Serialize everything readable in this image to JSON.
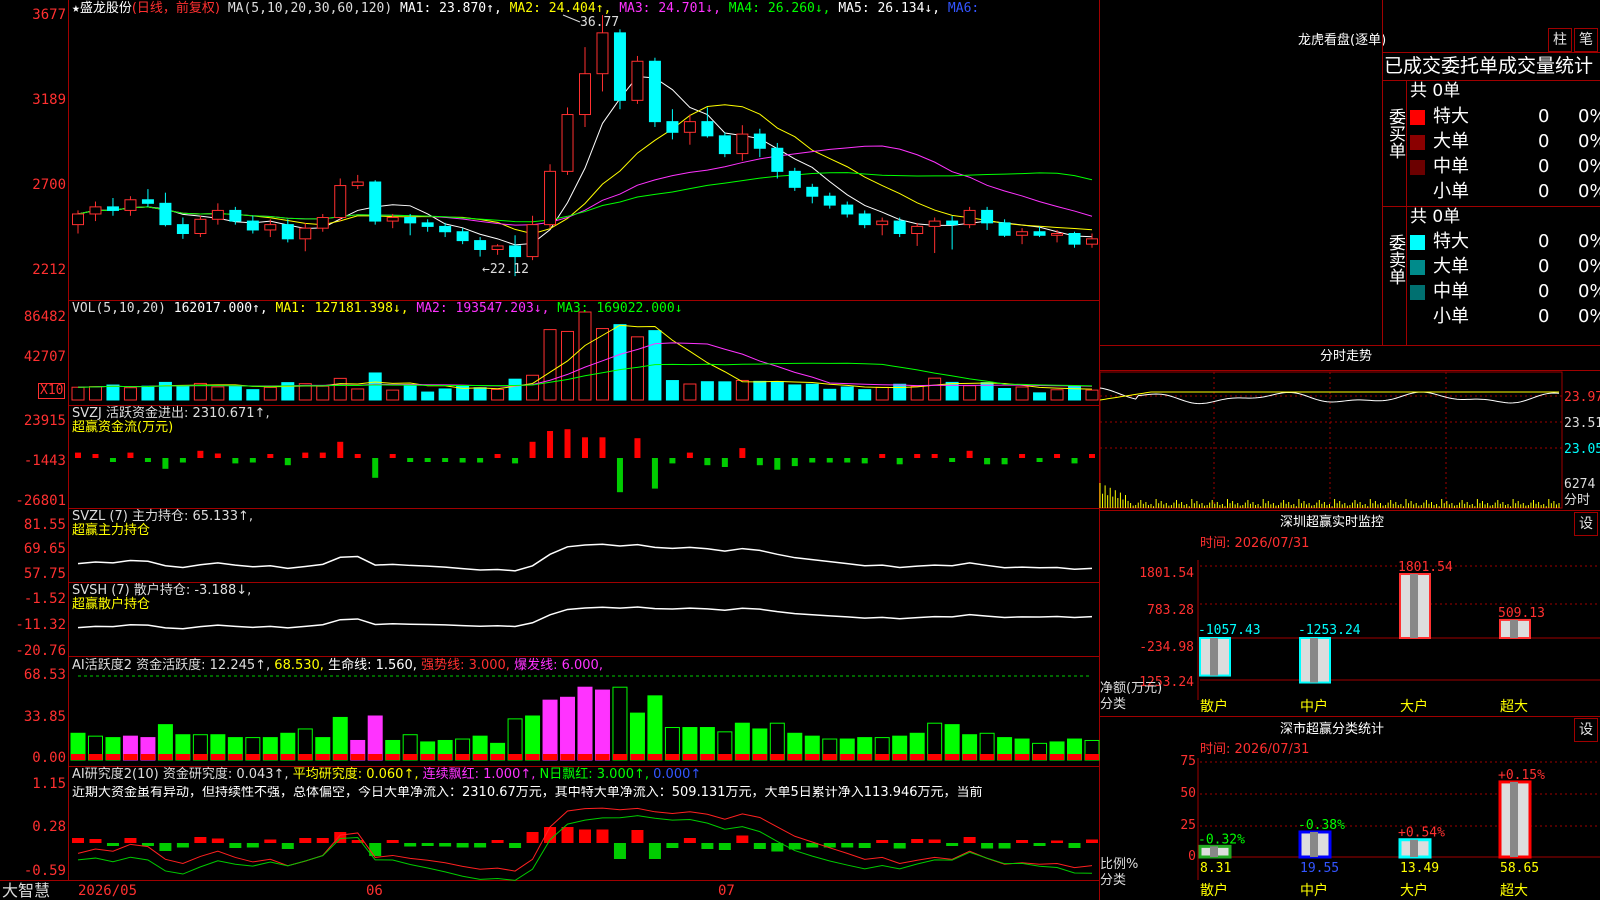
{
  "app": {
    "logo": "大智慧",
    "star": "★"
  },
  "main": {
    "stock": "盛龙股份",
    "mode": "(日线，前复权)",
    "ma_label": "MA(5,10,20,30,60,120)",
    "ma1": "MA1: 23.870↑,",
    "ma2": "MA2: 24.404↑,",
    "ma3": "MA3: 24.701↓,",
    "ma4": "MA4: 26.260↓,",
    "ma5": "MA5: 26.134↓,",
    "ma6": "MA6:",
    "yticks": [
      "3677",
      "3189",
      "2700",
      "2212"
    ],
    "high_label": "36.77",
    "low_label": "←22.12"
  },
  "vol": {
    "label": "VOL(5,10,20)",
    "value": "162017.000↑,",
    "ma1": "MA1: 127181.398↓,",
    "ma2": "MA2: 193547.203↓,",
    "ma3": "MA3: 169022.000↓",
    "yticks": [
      "86482",
      "42707"
    ],
    "unit": "X10"
  },
  "svzj": {
    "label": "SVZJ  活跃资金进出: 2310.671↑,",
    "sub": "超赢资金流(万元)",
    "yticks": [
      "23915",
      "-1443",
      "-26801"
    ]
  },
  "svzl": {
    "label": "SVZL (7) 主力持仓: 65.133↑,",
    "sub": "超赢主力持仓",
    "yticks": [
      "81.55",
      "69.65",
      "57.75"
    ]
  },
  "svsh": {
    "label": "SVSH (7) 散户持仓: -3.188↓,",
    "sub": "超赢散户持仓",
    "yticks": [
      "-1.52",
      "-11.32",
      "-20.76"
    ]
  },
  "ai1": {
    "label": "AI活跃度2 资金活跃度: 12.245↑,",
    "v2": "68.530,",
    "v3": "生命线: 1.560,",
    "v4": "强势线: 3.000,",
    "v5": "爆发线: 6.000,",
    "yticks": [
      "68.53",
      "33.85",
      "0.00"
    ]
  },
  "ai2": {
    "label": "AI研究度2(10) 资金研究度: 0.043↑,",
    "v2": "平均研究度: 0.060↑,",
    "v3": "连续飘红: 1.000↑,",
    "v4": "N日飘红: 3.000↑,",
    "v5": "0.000↑",
    "comment": "近期大资金虽有异动，但持续性不强，总体偏空，今日大单净流入：2310.67万元，其中特大单净流入：509.131万元，大单5日累计净入113.946万元，当前",
    "yticks": [
      "1.15",
      "0.28",
      "-0.59"
    ]
  },
  "xaxis": {
    "labels": [
      "2026/05",
      "06",
      "07"
    ]
  },
  "panel_lhb": {
    "title": "龙虎看盘(逐单)",
    "btn1": "柱",
    "btn2": "笔",
    "subtitle": "已成交委托单成交量统计",
    "buy": {
      "side": "委买单",
      "total": "共 0单",
      "rows": [
        {
          "name": "特大",
          "count": "0",
          "pct": "0%",
          "color": "#ff0000"
        },
        {
          "name": "大单",
          "count": "0",
          "pct": "0%",
          "color": "#8b0000"
        },
        {
          "name": "中单",
          "count": "0",
          "pct": "0%",
          "color": "#6b0000"
        },
        {
          "name": "小单",
          "count": "0",
          "pct": "0%",
          "color": "#000000"
        }
      ]
    },
    "sell": {
      "side": "委卖单",
      "total": "共 0单",
      "rows": [
        {
          "name": "特大",
          "count": "0",
          "pct": "0%",
          "color": "#00ffff"
        },
        {
          "name": "大单",
          "count": "0",
          "pct": "0%",
          "color": "#008b8b"
        },
        {
          "name": "中单",
          "count": "0",
          "pct": "0%",
          "color": "#007070"
        },
        {
          "name": "小单",
          "count": "0",
          "pct": "0%",
          "color": "#000000"
        }
      ]
    }
  },
  "panel_fs": {
    "title": "分时走势",
    "yticks": [
      "23.97",
      "23.51",
      "23.05"
    ],
    "vol": "6274",
    "vol_label": "分时"
  },
  "panel_sz": {
    "title": "深圳超赢实时监控",
    "btn": "设",
    "time": "时间: 2026/07/31",
    "yticks": [
      "1801.54",
      "783.28",
      "-234.98",
      "-1253.24"
    ],
    "ylabel": "净额(万元)",
    "xlabel": "分类",
    "bars": [
      {
        "name": "散户",
        "value": -1057.43,
        "label": "-1057.43"
      },
      {
        "name": "中户",
        "value": -1253.24,
        "label": "-1253.24"
      },
      {
        "name": "大户",
        "value": 1801.54,
        "label": "1801.54"
      },
      {
        "name": "超大",
        "value": 509.13,
        "label": "509.13"
      }
    ]
  },
  "panel_fl": {
    "title": "深市超赢分类统计",
    "btn": "设",
    "time": "时间: 2026/07/31",
    "yticks": [
      "75",
      "50",
      "25",
      "0"
    ],
    "ylabel": "比例%",
    "xlabel": "分类",
    "bars": [
      {
        "name": "散户",
        "value": 8.31,
        "change": "-0.32%",
        "color": "#22aa22"
      },
      {
        "name": "中户",
        "value": 19.55,
        "change": "-0.38%",
        "color": "#0000ff"
      },
      {
        "name": "大户",
        "value": 13.49,
        "change": "+0.54%",
        "color": "#00ffff"
      },
      {
        "name": "超大",
        "value": 58.65,
        "change": "+0.15%",
        "color": "#ff0000"
      }
    ]
  },
  "chart_data": {
    "type": "candlestick",
    "title": "盛龙股份",
    "price_range": [
      22.12,
      36.77
    ],
    "ohlc": [
      [
        25.0,
        25.8,
        24.5,
        25.6
      ],
      [
        25.6,
        26.3,
        25.2,
        26.0
      ],
      [
        26.0,
        26.5,
        25.5,
        25.8
      ],
      [
        25.8,
        26.6,
        25.5,
        26.4
      ],
      [
        26.4,
        27.0,
        26.0,
        26.2
      ],
      [
        26.2,
        26.8,
        24.9,
        25.0
      ],
      [
        25.0,
        25.4,
        24.2,
        24.5
      ],
      [
        24.5,
        25.5,
        24.3,
        25.3
      ],
      [
        25.3,
        26.2,
        25.0,
        25.8
      ],
      [
        25.8,
        26.0,
        25.0,
        25.2
      ],
      [
        25.2,
        25.5,
        24.5,
        24.7
      ],
      [
        24.7,
        25.3,
        24.3,
        25.0
      ],
      [
        25.0,
        25.3,
        24.0,
        24.2
      ],
      [
        24.2,
        25.1,
        23.5,
        24.8
      ],
      [
        24.8,
        25.6,
        24.6,
        25.4
      ],
      [
        25.4,
        27.6,
        25.2,
        27.2
      ],
      [
        27.2,
        27.8,
        27.0,
        27.4
      ],
      [
        27.4,
        27.5,
        25.0,
        25.2
      ],
      [
        25.2,
        25.6,
        24.8,
        25.4
      ],
      [
        25.4,
        25.6,
        24.4,
        25.1
      ],
      [
        25.1,
        25.3,
        24.6,
        24.9
      ],
      [
        24.9,
        25.1,
        24.3,
        24.6
      ],
      [
        24.6,
        24.8,
        23.9,
        24.1
      ],
      [
        24.1,
        24.3,
        23.2,
        23.6
      ],
      [
        23.6,
        23.9,
        23.3,
        23.8
      ],
      [
        23.8,
        24.4,
        22.1,
        23.2
      ],
      [
        23.2,
        25.5,
        23.0,
        25.0
      ],
      [
        25.0,
        28.4,
        24.8,
        28.0
      ],
      [
        28.0,
        31.6,
        27.8,
        31.2
      ],
      [
        31.2,
        35.0,
        30.5,
        33.5
      ],
      [
        33.5,
        36.8,
        32.5,
        35.8
      ],
      [
        35.8,
        36.0,
        31.5,
        32.0
      ],
      [
        32.0,
        34.5,
        31.8,
        34.2
      ],
      [
        34.2,
        34.4,
        30.5,
        30.8
      ],
      [
        30.8,
        31.5,
        29.8,
        30.2
      ],
      [
        30.2,
        31.2,
        29.5,
        30.8
      ],
      [
        30.8,
        31.6,
        29.9,
        30.0
      ],
      [
        30.0,
        30.2,
        28.8,
        29.0
      ],
      [
        29.0,
        30.6,
        28.6,
        30.1
      ],
      [
        30.1,
        30.4,
        28.8,
        29.3
      ],
      [
        29.3,
        29.6,
        27.6,
        28.0
      ],
      [
        28.0,
        28.2,
        26.9,
        27.1
      ],
      [
        27.1,
        27.3,
        26.2,
        26.6
      ],
      [
        26.6,
        26.8,
        25.9,
        26.1
      ],
      [
        26.1,
        26.3,
        25.4,
        25.6
      ],
      [
        25.6,
        25.8,
        24.8,
        25.0
      ],
      [
        25.0,
        25.4,
        24.4,
        25.2
      ],
      [
        25.2,
        25.4,
        24.3,
        24.5
      ],
      [
        24.5,
        25.1,
        23.8,
        24.9
      ],
      [
        24.9,
        25.4,
        23.4,
        25.2
      ],
      [
        25.2,
        25.5,
        23.6,
        25.0
      ],
      [
        25.0,
        26.0,
        24.8,
        25.8
      ],
      [
        25.8,
        26.0,
        24.7,
        25.1
      ],
      [
        25.1,
        25.3,
        24.3,
        24.4
      ],
      [
        24.4,
        24.8,
        23.9,
        24.6
      ],
      [
        24.6,
        24.9,
        24.3,
        24.4
      ],
      [
        24.4,
        24.7,
        24.0,
        24.5
      ],
      [
        24.5,
        24.6,
        23.7,
        23.9
      ],
      [
        23.9,
        24.5,
        23.7,
        24.2
      ]
    ]
  }
}
